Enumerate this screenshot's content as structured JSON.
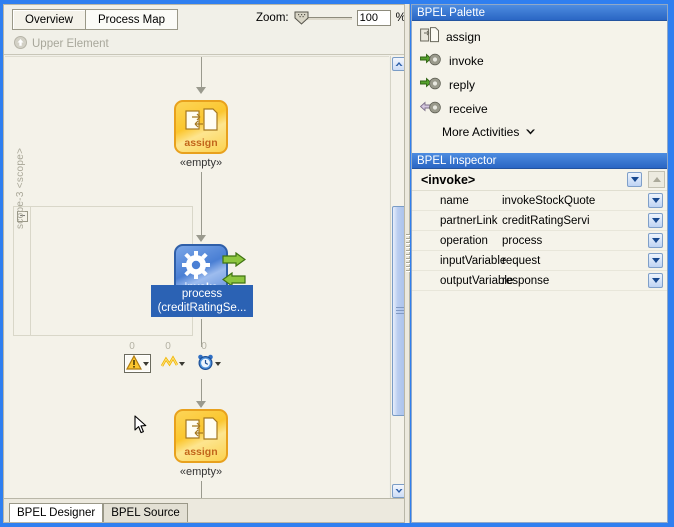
{
  "editor": {
    "tabs": [
      {
        "label": "Overview",
        "active": true
      },
      {
        "label": "Process Map",
        "active": false
      }
    ],
    "zoom": {
      "label": "Zoom:",
      "value": "100",
      "unit": "%"
    },
    "breadcrumb": {
      "label": "Upper Element",
      "icon": "up-circle-icon"
    },
    "bottom_tabs": [
      {
        "label": "BPEL Designer",
        "active": true
      },
      {
        "label": "BPEL Source",
        "active": false
      }
    ]
  },
  "canvas": {
    "nodes": [
      {
        "type": "assign",
        "tag": "assign",
        "caption": "«empty»"
      },
      {
        "type": "invoke",
        "tag": "invoke",
        "caption": ""
      },
      {
        "type": "assign",
        "tag": "assign",
        "caption": "«empty»"
      }
    ],
    "selected_label": "process\n(creditRatingSe...",
    "scope": {
      "label": "scope-3 <scope>",
      "collapse": "−"
    },
    "minibar": [
      {
        "name": "warning-icon",
        "count": "0",
        "active": true
      },
      {
        "name": "fault-icon",
        "count": "0",
        "active": false
      },
      {
        "name": "timer-icon",
        "count": "0",
        "active": false
      }
    ]
  },
  "palette": {
    "title": "BPEL Palette",
    "items": [
      {
        "label": "assign",
        "icon": "assign-icon"
      },
      {
        "label": "invoke",
        "icon": "invoke-icon"
      },
      {
        "label": "reply",
        "icon": "reply-icon"
      },
      {
        "label": "receive",
        "icon": "receive-icon"
      }
    ],
    "more": "More Activities"
  },
  "inspector": {
    "title": "BPEL Inspector",
    "element": "<invoke>",
    "rows": [
      {
        "key": "name",
        "value": "invokeStockQuotе"
      },
      {
        "key": "partnerLink",
        "value": "creditRatingServi"
      },
      {
        "key": "operation",
        "value": "process"
      },
      {
        "key": "inputVariable",
        "value": "request"
      },
      {
        "key": "outputVariable",
        "value": "response"
      }
    ]
  },
  "colors": {
    "accent": "#2a66c4",
    "selection": "#2b62b4",
    "canvas_bg": "#f4f2e9",
    "assign_node": "#fbc62e",
    "invoke_node": "#4a7fd4"
  }
}
